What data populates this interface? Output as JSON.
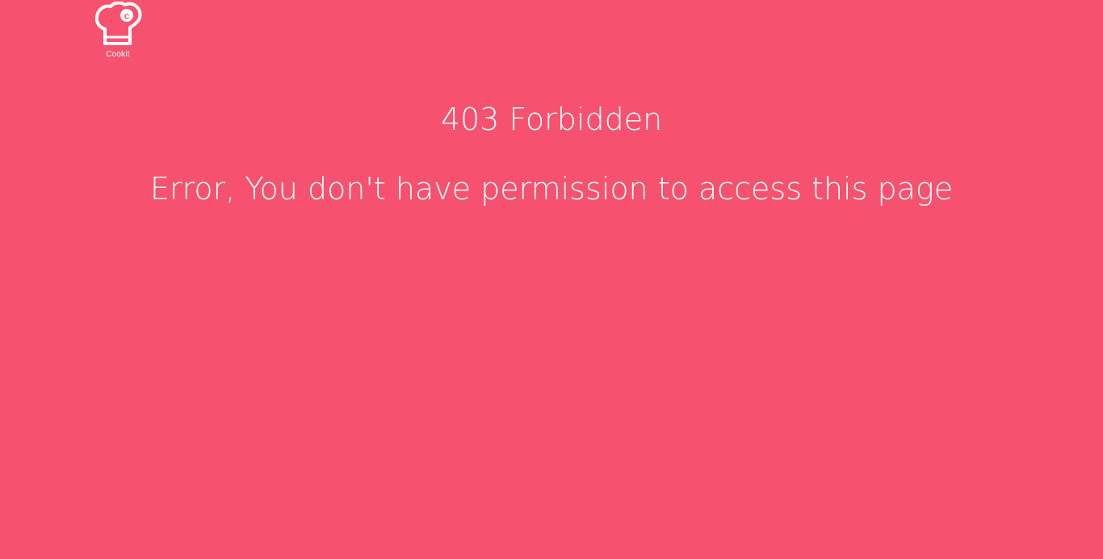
{
  "brand": {
    "logo_text": "Cookit",
    "logo_icon": "chef-hat-icon"
  },
  "error": {
    "title": "403 Forbidden",
    "message": "Error, You don't have permission to access this page"
  },
  "colors": {
    "background": "#f6526f",
    "foreground": "#ffffff"
  }
}
